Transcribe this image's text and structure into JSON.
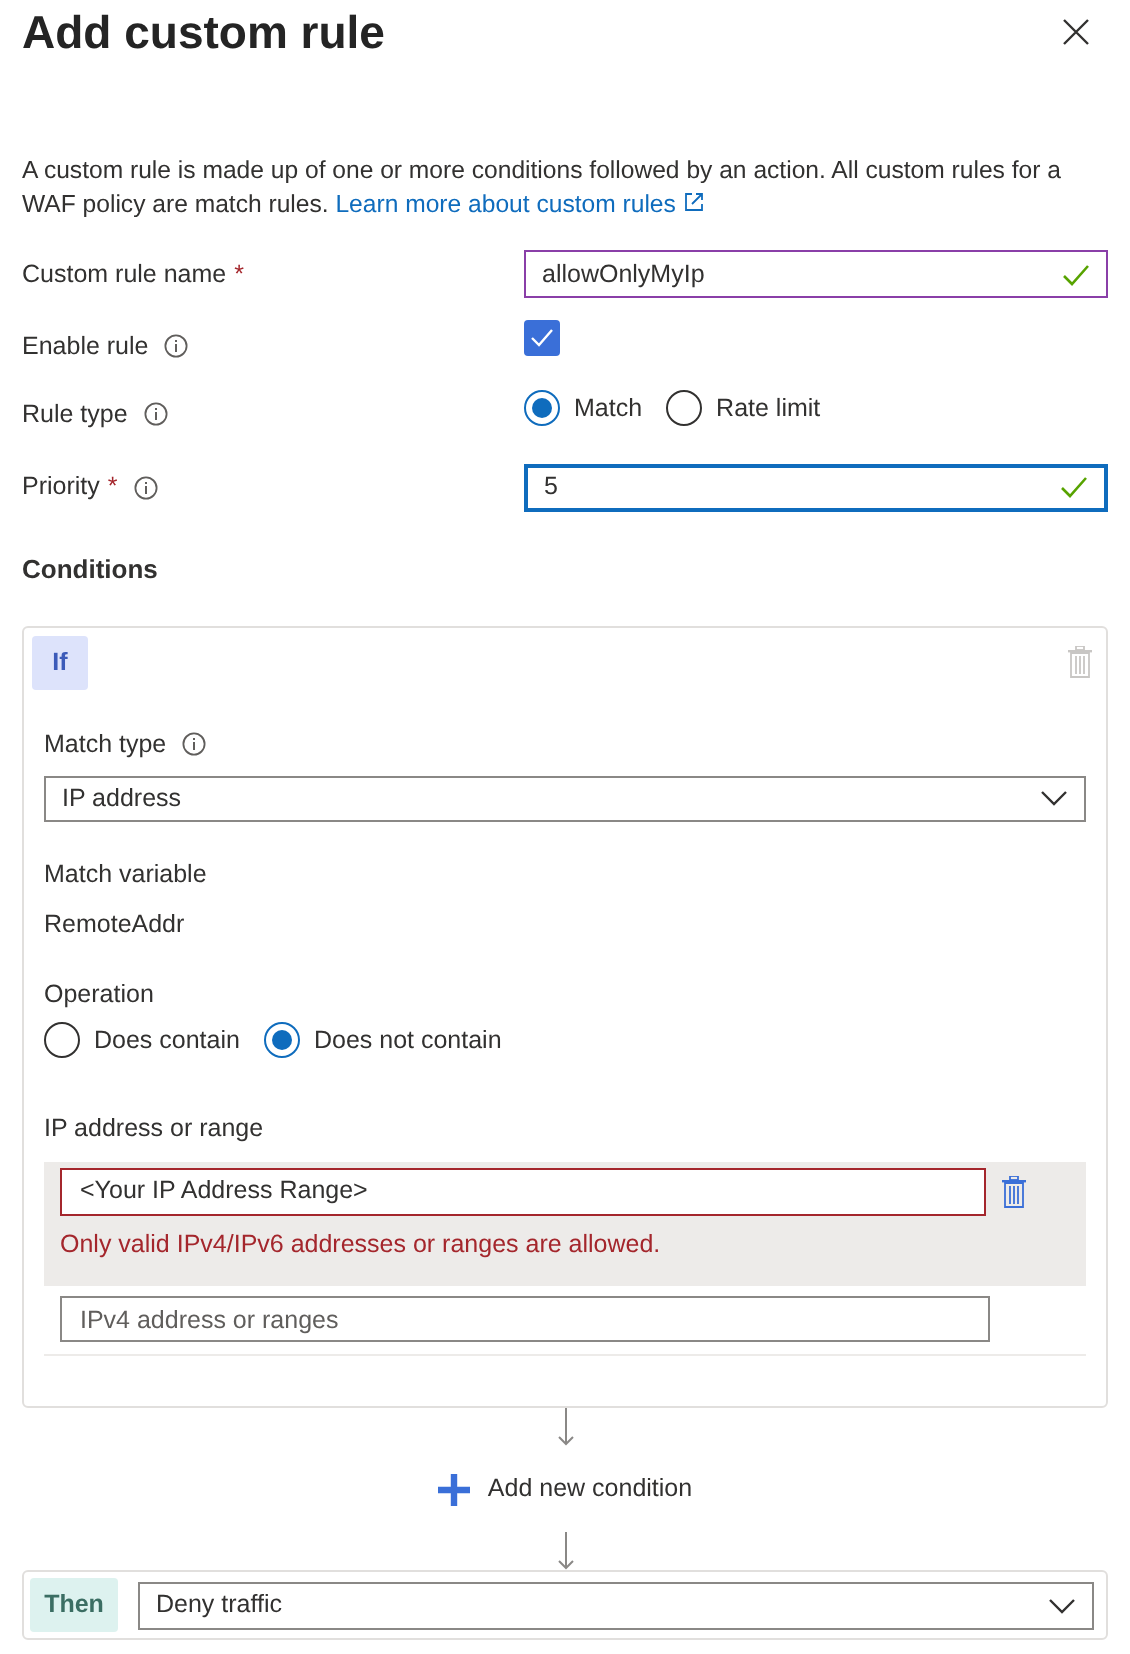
{
  "panel_title": "Add custom rule",
  "description": "A custom rule is made up of one or more conditions followed by an action. All custom rules for a WAF policy are match rules.",
  "learn_more_link": "Learn more about custom rules",
  "fields": [
    {
      "kind": "text",
      "label": "Custom rule name",
      "required_mark": "*",
      "info": false,
      "value": "allowOnlyMyIp",
      "valid": true,
      "hovered": true
    },
    {
      "kind": "checkbox",
      "label": "Enable rule",
      "info": true,
      "checked": true
    },
    {
      "kind": "radio",
      "label": "Rule type",
      "info": true,
      "options": [
        {
          "label": "Match",
          "selected": true
        },
        {
          "label": "Rate limit",
          "selected": false
        }
      ]
    },
    {
      "kind": "text",
      "label": "Priority",
      "required_mark": "*",
      "info": true,
      "value": "5",
      "valid": true,
      "focused": true
    }
  ],
  "conditions_heading": "Conditions",
  "condition": {
    "badge": "If",
    "match_type_label": "Match type",
    "match_type": "IP address",
    "match_variable_label": "Match variable",
    "match_variable": "RemoteAddr",
    "operation_label": "Operation",
    "operation_options": [
      {
        "label": "Does contain",
        "selected": false
      },
      {
        "label": "Does not contain",
        "selected": true
      }
    ],
    "ip_label": "IP address or range",
    "ip_entries": [
      {
        "value": "<Your IP Address Range>",
        "error": "Only valid IPv4/IPv6 addresses or ranges are allowed."
      }
    ],
    "ip_new_placeholder": "IPv4 address or ranges"
  },
  "add_condition": "Add new condition",
  "then": {
    "badge": "Then",
    "action": "Deny traffic"
  }
}
